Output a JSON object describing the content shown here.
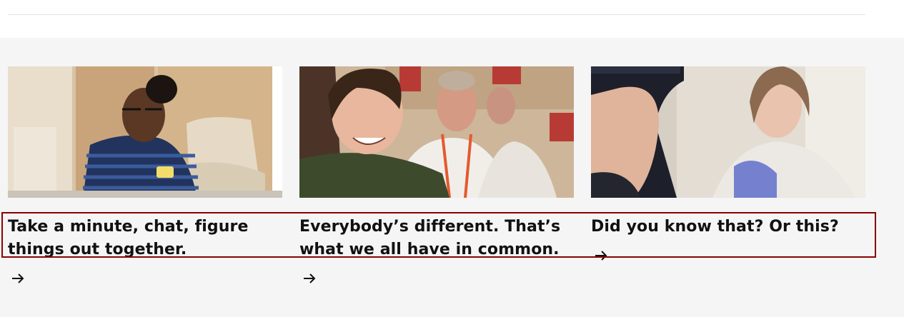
{
  "cards": [
    {
      "title": "Take a minute, chat, figure things out together."
    },
    {
      "title": "Everybody’s different. That’s what we all have in common."
    },
    {
      "title": "Did you know that? Or this?"
    }
  ]
}
